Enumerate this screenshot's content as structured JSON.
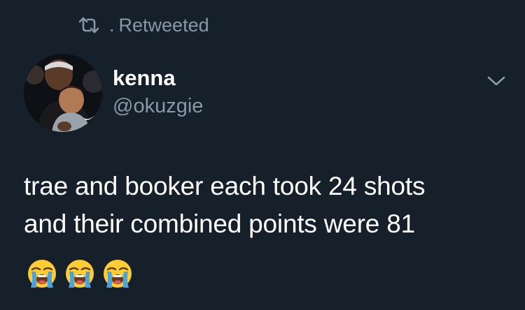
{
  "retweet_banner": {
    "icon": "retweet-icon",
    "prefix": ".",
    "label": "Retweeted"
  },
  "author": {
    "display_name": "kenna",
    "handle": "@okuzgie",
    "avatar": "avatar-photo"
  },
  "menu": {
    "icon": "chevron-down-icon"
  },
  "tweet": {
    "lines": [
      "trae and booker each took 24 shots",
      "and their combined points were 81"
    ],
    "emojis": [
      "loudly-crying-face",
      "loudly-crying-face",
      "loudly-crying-face"
    ]
  },
  "colors": {
    "background": "#15202b",
    "primary_text": "#ffffff",
    "secondary_text": "#8899a6"
  }
}
